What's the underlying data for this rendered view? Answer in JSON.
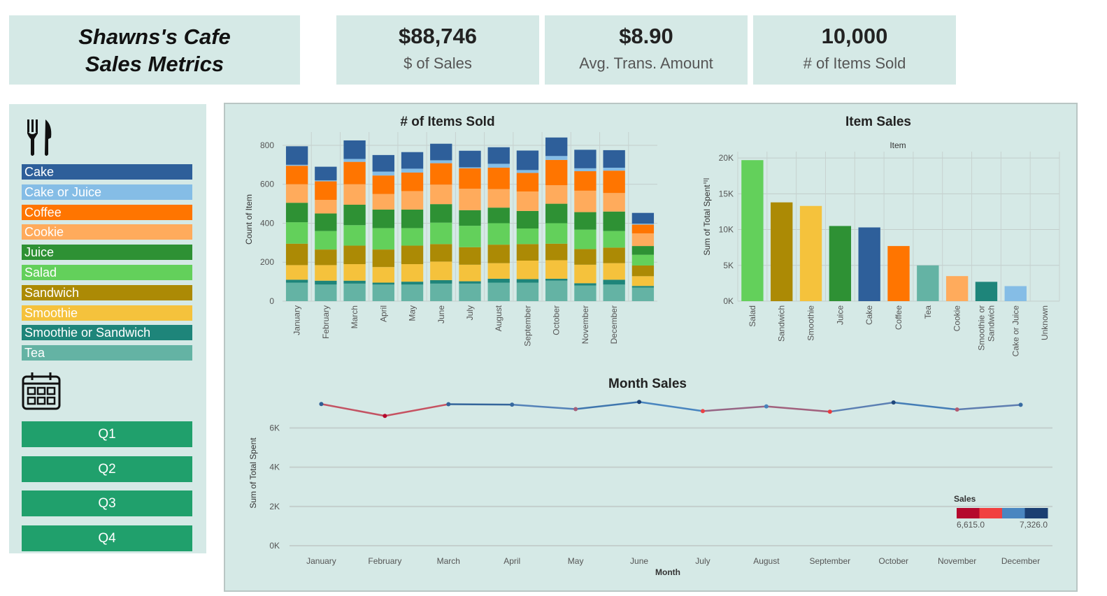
{
  "header": {
    "title_line1": "Shawns's Cafe",
    "title_line2": "Sales Metrics"
  },
  "kpis": {
    "sales": {
      "value": "$88,746",
      "label": "$ of Sales"
    },
    "avg": {
      "value": "$8.90",
      "label": "Avg. Trans. Amount"
    },
    "items": {
      "value": "10,000",
      "label": "# of Items Sold"
    }
  },
  "legend": [
    {
      "label": "Cake",
      "color": "#2e5f9a"
    },
    {
      "label": "Cake or Juice",
      "color": "#85bde6"
    },
    {
      "label": "Coffee",
      "color": "#ff7500"
    },
    {
      "label": "Cookie",
      "color": "#ffab5c"
    },
    {
      "label": "Juice",
      "color": "#2e9134"
    },
    {
      "label": "Salad",
      "color": "#63d05b"
    },
    {
      "label": "Sandwich",
      "color": "#ac8a05"
    },
    {
      "label": "Smoothie",
      "color": "#f5c23c"
    },
    {
      "label": "Smoothie or Sandwich",
      "color": "#1e857a"
    },
    {
      "label": "Tea",
      "color": "#64b3a4"
    }
  ],
  "quarters": [
    "Q1",
    "Q2",
    "Q3",
    "Q4"
  ],
  "chart_data": [
    {
      "type": "bar",
      "stacked": true,
      "title": "# of Items Sold",
      "ylabel": "Count of Item",
      "xlabel": "",
      "ylim": [
        0,
        850
      ],
      "yticks": [
        "0",
        "200",
        "400",
        "600",
        "800"
      ],
      "categories": [
        "January",
        "February",
        "March",
        "April",
        "May",
        "June",
        "July",
        "August",
        "September",
        "October",
        "November",
        "December",
        ""
      ],
      "series": [
        {
          "name": "Tea",
          "color": "#64b3a4",
          "values": [
            95,
            85,
            90,
            85,
            85,
            90,
            90,
            95,
            95,
            105,
            80,
            85,
            70
          ]
        },
        {
          "name": "Smoothie or Sandwich",
          "color": "#1e857a",
          "values": [
            15,
            20,
            15,
            10,
            15,
            18,
            12,
            20,
            18,
            10,
            12,
            25,
            8
          ]
        },
        {
          "name": "Smoothie",
          "color": "#f5c23c",
          "values": [
            75,
            80,
            85,
            80,
            90,
            95,
            85,
            80,
            95,
            95,
            95,
            85,
            50
          ]
        },
        {
          "name": "Sandwich",
          "color": "#ac8a05",
          "values": [
            110,
            80,
            95,
            90,
            95,
            90,
            90,
            95,
            85,
            85,
            80,
            80,
            55
          ]
        },
        {
          "name": "Salad",
          "color": "#63d05b",
          "values": [
            110,
            95,
            105,
            110,
            90,
            110,
            110,
            110,
            80,
            105,
            100,
            85,
            55
          ]
        },
        {
          "name": "Juice",
          "color": "#2e9134",
          "values": [
            100,
            90,
            105,
            95,
            95,
            95,
            80,
            80,
            90,
            100,
            90,
            100,
            45
          ]
        },
        {
          "name": "Cookie",
          "color": "#ffab5c",
          "values": [
            95,
            70,
            105,
            80,
            95,
            100,
            110,
            95,
            100,
            95,
            110,
            95,
            65
          ]
        },
        {
          "name": "Coffee",
          "color": "#ff7500",
          "values": [
            95,
            95,
            115,
            95,
            95,
            110,
            105,
            110,
            95,
            130,
            100,
            115,
            45
          ]
        },
        {
          "name": "Cake or Juice",
          "color": "#85bde6",
          "values": [
            5,
            5,
            15,
            20,
            20,
            15,
            5,
            20,
            15,
            20,
            15,
            15,
            5
          ]
        },
        {
          "name": "Cake",
          "color": "#2e5f9a",
          "values": [
            95,
            70,
            95,
            85,
            85,
            85,
            85,
            85,
            100,
            95,
            95,
            90,
            55
          ]
        }
      ]
    },
    {
      "type": "bar",
      "title": "Item Sales",
      "subtitle": "Item",
      "ylabel": "Sum of Total Spent",
      "ylim": [
        0,
        20500
      ],
      "yticks": [
        "0K",
        "5K",
        "10K",
        "15K",
        "20K"
      ],
      "categories": [
        "Salad",
        "Sandwich",
        "Smoothie",
        "Juice",
        "Cake",
        "Coffee",
        "Tea",
        "Cookie",
        "Smoothie or Sandwich",
        "Cake or Juice",
        "Unknown"
      ],
      "category_lines": [
        [
          "Salad"
        ],
        [
          "Sandwich"
        ],
        [
          "Smoothie"
        ],
        [
          "Juice"
        ],
        [
          "Cake"
        ],
        [
          "Coffee"
        ],
        [
          "Tea"
        ],
        [
          "Cookie"
        ],
        [
          "Smoothie or",
          "Sandwich"
        ],
        [
          "Cake or Juice"
        ],
        [
          "Unknown"
        ]
      ],
      "values": [
        19700,
        13800,
        13300,
        10500,
        10300,
        7700,
        5000,
        3500,
        2700,
        2100,
        0
      ],
      "colors": [
        "#63d05b",
        "#ac8a05",
        "#f5c23c",
        "#2e9134",
        "#2e5f9a",
        "#ff7500",
        "#64b3a4",
        "#ffab5c",
        "#1e857a",
        "#85bde6",
        "#cccccc"
      ]
    },
    {
      "type": "line",
      "title": "Month Sales",
      "xlabel": "Month",
      "ylabel": "Sum of Total Spent",
      "ylim": [
        0,
        7300
      ],
      "yticks": [
        "0K",
        "2K",
        "4K",
        "6K"
      ],
      "x": [
        "January",
        "February",
        "March",
        "April",
        "May",
        "June",
        "July",
        "August",
        "September",
        "October",
        "November",
        "December"
      ],
      "values": [
        7220,
        6615,
        7210,
        7190,
        6960,
        7326,
        6860,
        7100,
        6830,
        7300,
        6940,
        7180
      ],
      "color_legend": {
        "title": "Sales",
        "min_label": "6,615.0",
        "max_label": "7,326.0",
        "min": 6615,
        "max": 7326,
        "colors": [
          "#b5092d",
          "#f14040",
          "#4a86c0",
          "#1b3f72"
        ]
      }
    }
  ]
}
